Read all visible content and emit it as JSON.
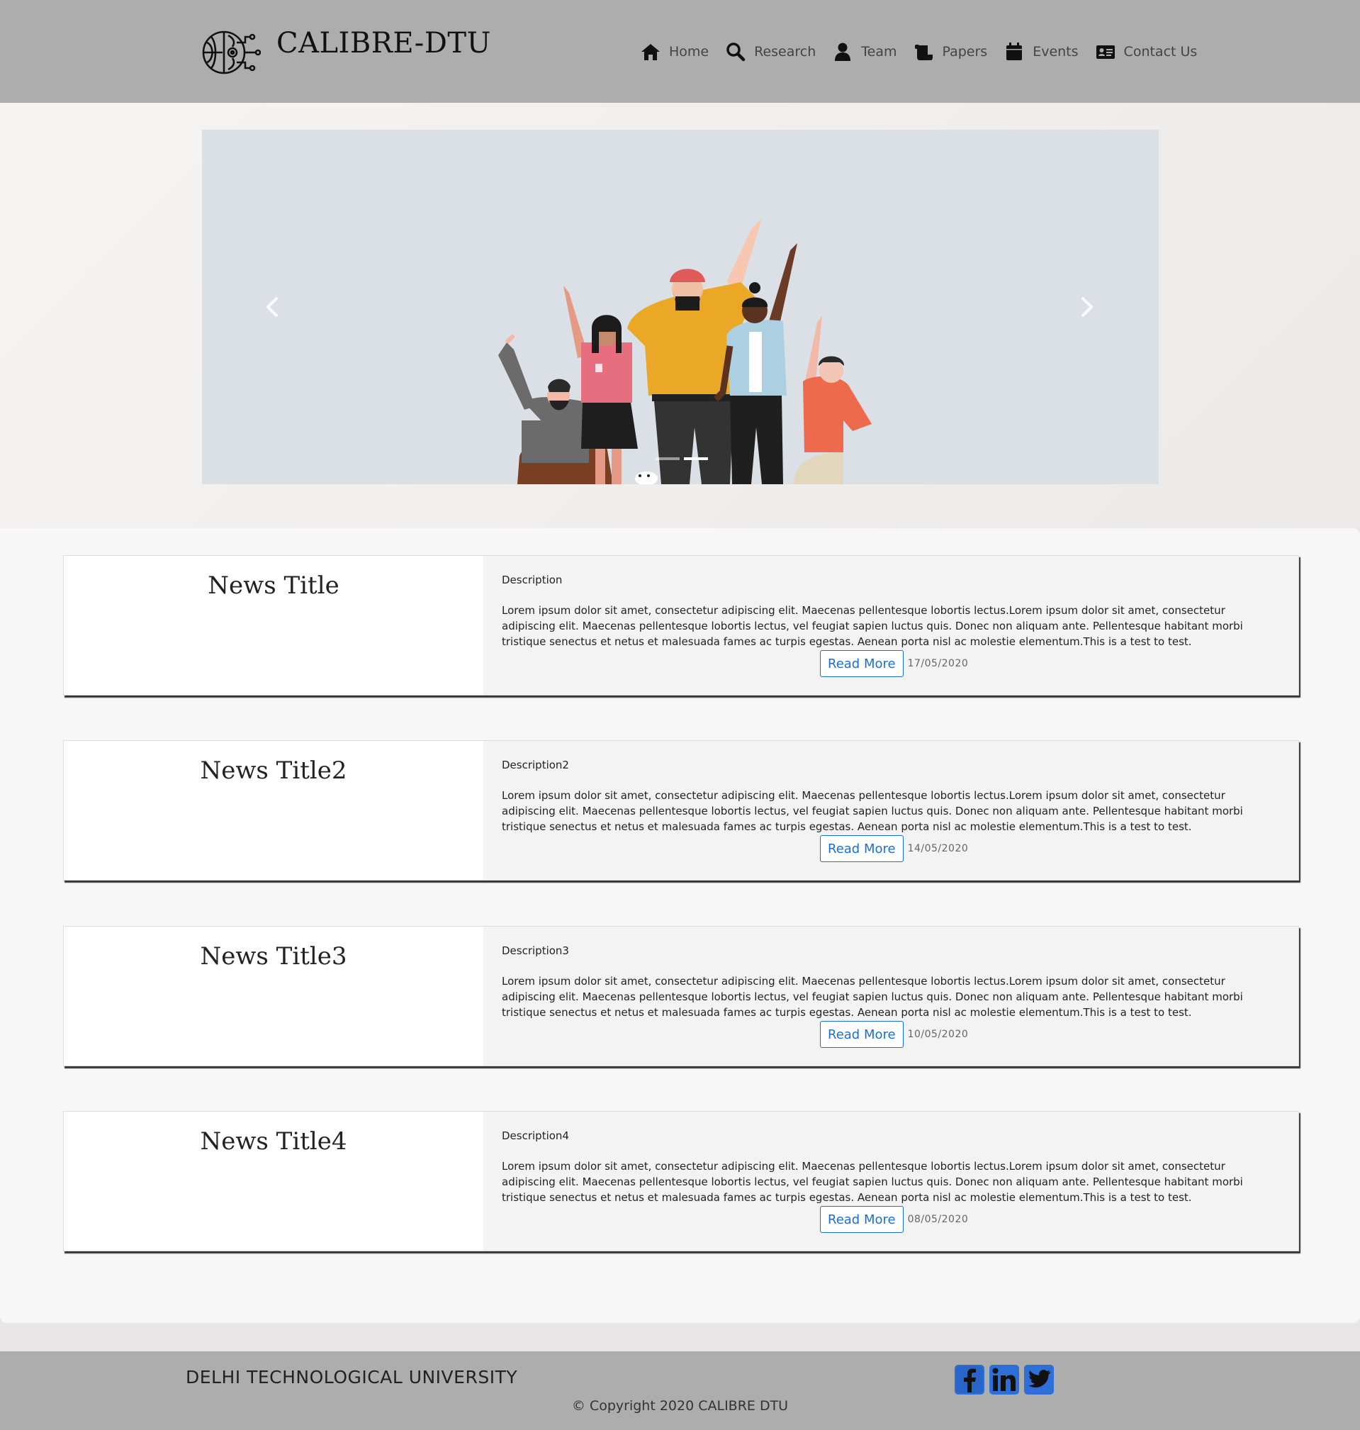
{
  "brand": {
    "name": "CALIBRE-DTU"
  },
  "nav": {
    "items": [
      {
        "label": "Home",
        "icon": "home-icon"
      },
      {
        "label": "Research",
        "icon": "search-icon"
      },
      {
        "label": "Team",
        "icon": "user-icon"
      },
      {
        "label": "Papers",
        "icon": "scroll-icon"
      },
      {
        "label": "Events",
        "icon": "calendar-icon"
      },
      {
        "label": "Contact Us",
        "icon": "id-card-icon"
      }
    ]
  },
  "carousel": {
    "slide_count": 2,
    "active_slide": 2,
    "illustration": "group-of-people-waving"
  },
  "news": [
    {
      "title": "News Title",
      "description": "Description",
      "body": "Lorem ipsum dolor sit amet, consectetur adipiscing elit. Maecenas pellentesque lobortis lectus.Lorem ipsum dolor sit amet, consectetur adipiscing elit. Maecenas pellentesque lobortis lectus, vel feugiat sapien luctus quis. Donec non aliquam ante. Pellentesque habitant morbi tristique senectus et netus et malesuada fames ac turpis egestas. Aenean porta nisl ac molestie elementum.This is a test to test.",
      "read_more": "Read More",
      "date": "17/05/2020"
    },
    {
      "title": "News Title2",
      "description": "Description2",
      "body": "Lorem ipsum dolor sit amet, consectetur adipiscing elit. Maecenas pellentesque lobortis lectus.Lorem ipsum dolor sit amet, consectetur adipiscing elit. Maecenas pellentesque lobortis lectus, vel feugiat sapien luctus quis. Donec non aliquam ante. Pellentesque habitant morbi tristique senectus et netus et malesuada fames ac turpis egestas. Aenean porta nisl ac molestie elementum.This is a test to test.",
      "read_more": "Read More",
      "date": "14/05/2020"
    },
    {
      "title": "News Title3",
      "description": "Description3",
      "body": "Lorem ipsum dolor sit amet, consectetur adipiscing elit. Maecenas pellentesque lobortis lectus.Lorem ipsum dolor sit amet, consectetur adipiscing elit. Maecenas pellentesque lobortis lectus, vel feugiat sapien luctus quis. Donec non aliquam ante. Pellentesque habitant morbi tristique senectus et netus et malesuada fames ac turpis egestas. Aenean porta nisl ac molestie elementum.This is a test to test.",
      "read_more": "Read More",
      "date": "10/05/2020"
    },
    {
      "title": "News Title4",
      "description": "Description4",
      "body": "Lorem ipsum dolor sit amet, consectetur adipiscing elit. Maecenas pellentesque lobortis lectus.Lorem ipsum dolor sit amet, consectetur adipiscing elit. Maecenas pellentesque lobortis lectus, vel feugiat sapien luctus quis. Donec non aliquam ante. Pellentesque habitant morbi tristique senectus et netus et malesuada fames ac turpis egestas. Aenean porta nisl ac molestie elementum.This is a test to test.",
      "read_more": "Read More",
      "date": "08/05/2020"
    }
  ],
  "footer": {
    "university": "DELHI TECHNOLOGICAL UNIVERSITY",
    "copyright": "© Copyright 2020 CALIBRE DTU",
    "socials": [
      "facebook-icon",
      "linkedin-icon",
      "twitter-icon"
    ]
  },
  "colors": {
    "header_bg": "#adadad",
    "link_blue": "#1a6fd0",
    "carousel_bg": "#dbe0e7",
    "social_blue": "#2d6fd6"
  }
}
